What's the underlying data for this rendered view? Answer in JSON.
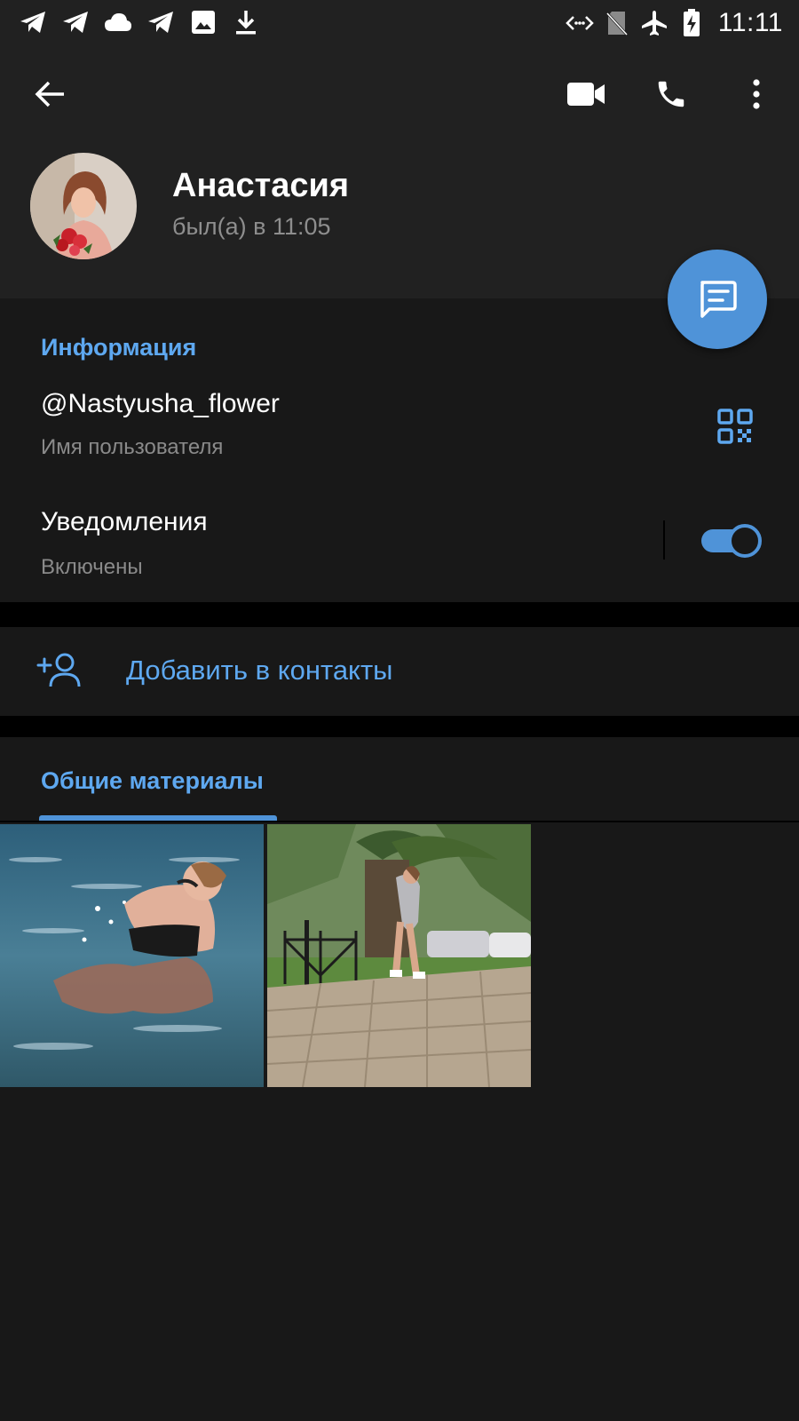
{
  "status_bar": {
    "left_icons": [
      "telegram-icon",
      "telegram-icon",
      "cloud-icon",
      "telegram-icon",
      "image-icon",
      "download-icon"
    ],
    "right_icons": [
      "data-saver-icon",
      "no-sim-icon",
      "airplane-icon",
      "battery-charging-icon"
    ],
    "time": "11:11"
  },
  "toolbar": {
    "back_icon": "arrow-left-icon",
    "actions": [
      "video-call-icon",
      "phone-icon",
      "more-vert-icon"
    ]
  },
  "profile": {
    "name": "Анастасия",
    "status": "был(а) в 11:05"
  },
  "fab": {
    "icon": "message-icon"
  },
  "info": {
    "section_title": "Информация",
    "username": "@Nastyusha_flower",
    "username_caption": "Имя пользователя",
    "notifications_label": "Уведомления",
    "notifications_value": "Включены",
    "notifications_enabled": true
  },
  "add_contact": {
    "label": "Добавить в контакты",
    "icon": "add-person-icon"
  },
  "shared_media": {
    "tab_label": "Общие материалы",
    "items": [
      "photo-sea",
      "photo-palm-street"
    ]
  },
  "colors": {
    "accent": "#5ea8f0",
    "fab": "#4f93d8",
    "header_bg": "#212121",
    "body_bg": "#181818"
  }
}
